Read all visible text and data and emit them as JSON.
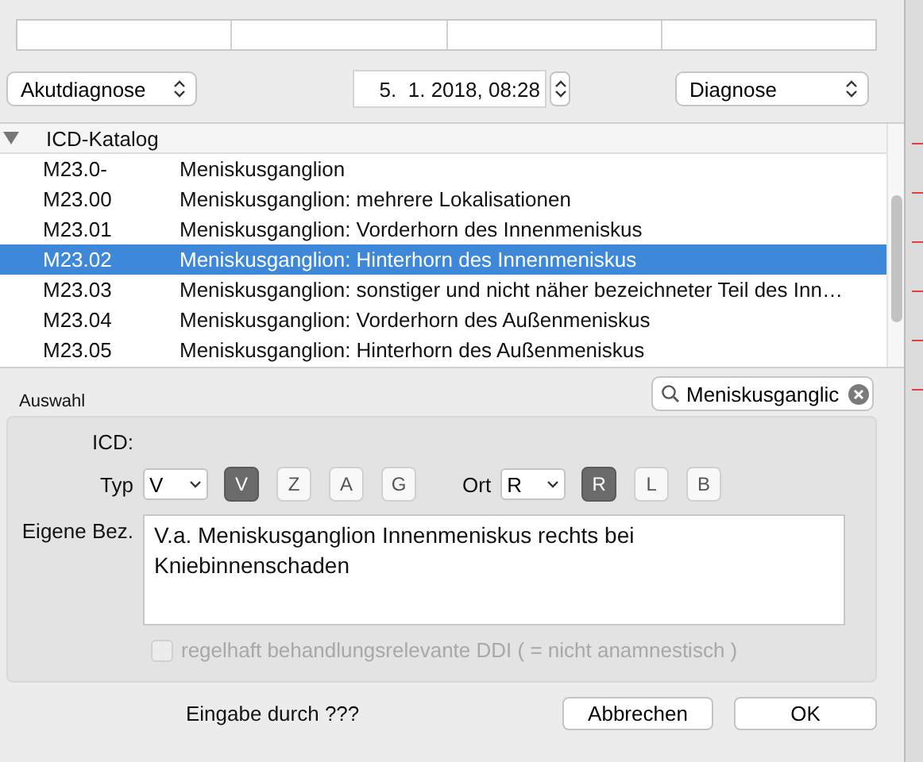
{
  "toolbar": {
    "category": {
      "value": "Akutdiagnose"
    },
    "datetime": {
      "value": "5.  1. 2018, 08:28"
    },
    "type": {
      "value": "Diagnose"
    }
  },
  "catalog": {
    "group": {
      "label": "ICD-Katalog",
      "expanded": true
    },
    "rows": [
      {
        "code": "M23.0-",
        "name": "Meniskusganglion",
        "selected": false
      },
      {
        "code": "M23.00",
        "name": "Meniskusganglion: mehrere Lokalisationen",
        "selected": false
      },
      {
        "code": "M23.01",
        "name": "Meniskusganglion: Vorderhorn des Innenmeniskus",
        "selected": false
      },
      {
        "code": "M23.02",
        "name": "Meniskusganglion: Hinterhorn des Innenmeniskus",
        "selected": true
      },
      {
        "code": "M23.03",
        "name": "Meniskusganglion: sonstiger und nicht näher bezeichneter Teil des Inn…",
        "selected": false
      },
      {
        "code": "M23.04",
        "name": "Meniskusganglion: Vorderhorn des Außenmeniskus",
        "selected": false
      },
      {
        "code": "M23.05",
        "name": "Meniskusganglion: Hinterhorn des Außenmeniskus",
        "selected": false
      }
    ]
  },
  "search": {
    "value": "Meniskusganglic"
  },
  "selection": {
    "title": "Auswahl",
    "icd_label": "ICD:",
    "typ": {
      "label": "Typ",
      "popup": "V",
      "options": [
        {
          "label": "V",
          "selected": true
        },
        {
          "label": "Z",
          "selected": false
        },
        {
          "label": "A",
          "selected": false
        },
        {
          "label": "G",
          "selected": false
        }
      ]
    },
    "ort": {
      "label": "Ort",
      "popup": "R",
      "options": [
        {
          "label": "R",
          "selected": true
        },
        {
          "label": "L",
          "selected": false
        },
        {
          "label": "B",
          "selected": false
        }
      ]
    },
    "own_label": "Eigene Bez.",
    "own_text": "V.a. Meniskusganglion Innenmeniskus rechts bei Kniebinnenschaden",
    "relevant": {
      "label": "regelhaft behandlungsrelevante DDI ( = nicht anamnestisch )",
      "checked": false,
      "disabled": true
    }
  },
  "footer": {
    "entered_by": "Eingabe durch ???",
    "buttons": [
      "Abbrechen",
      "OK"
    ]
  }
}
